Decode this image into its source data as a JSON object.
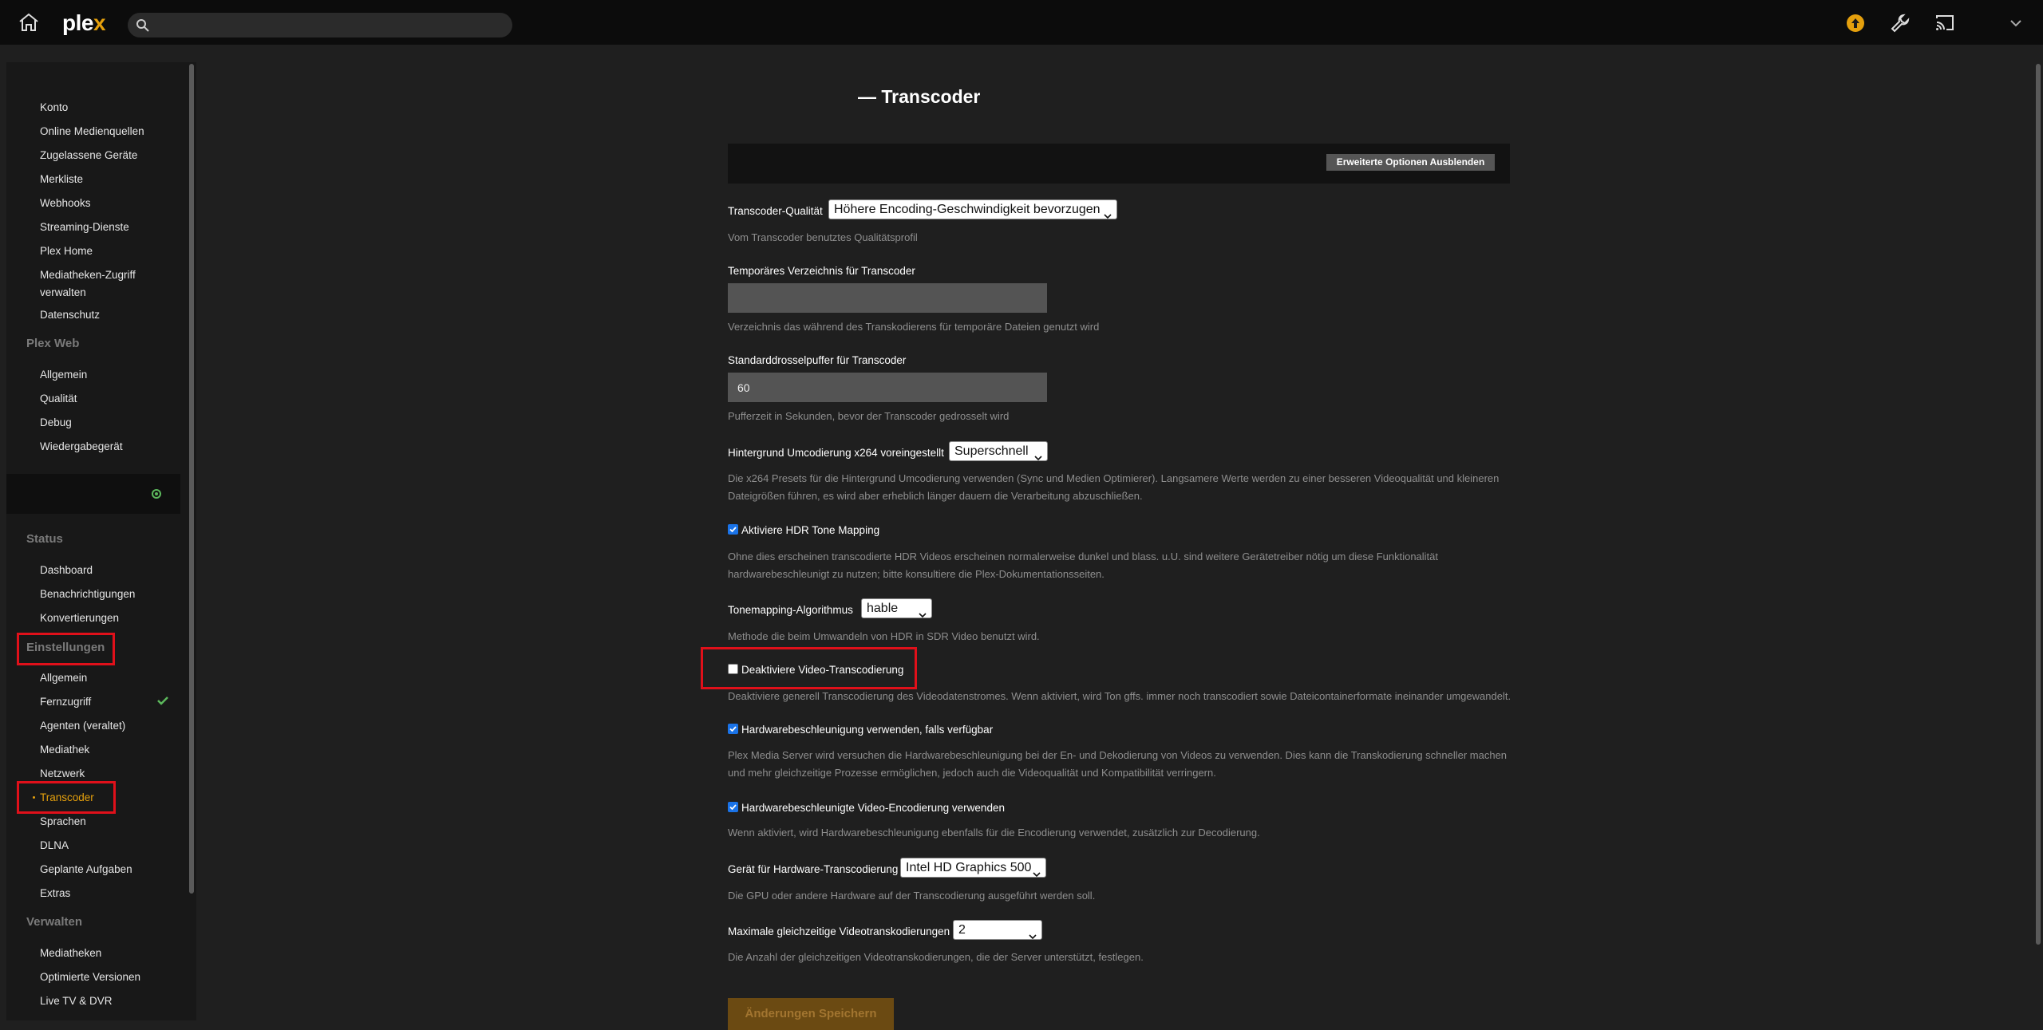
{
  "app": {
    "logo_pre": "ple",
    "logo_x": "x",
    "accent": "#e5a00d"
  },
  "search": {
    "placeholder": ""
  },
  "topbar_icons": [
    "home-icon",
    "upgrade-icon",
    "wrench-icon",
    "cast-icon",
    "chevron-down-icon"
  ],
  "sidebar": {
    "account_items": [
      "Konto",
      "Online Medienquellen",
      "Zugelassene Geräte",
      "Merkliste",
      "Webhooks",
      "Streaming-Dienste",
      "Plex Home",
      "Mediatheken-Zugriff verwalten",
      "Datenschutz"
    ],
    "plexweb_header": "Plex Web",
    "plexweb_items": [
      "Allgemein",
      "Qualität",
      "Debug",
      "Wiedergabegerät"
    ],
    "status_header": "Status",
    "status_items": [
      "Dashboard",
      "Benachrichtigungen",
      "Konvertierungen"
    ],
    "settings_header": "Einstellungen",
    "settings_items": [
      "Allgemein",
      "Fernzugriff",
      "Agenten (veraltet)",
      "Mediathek",
      "Netzwerk",
      "Transcoder",
      "Sprachen",
      "DLNA",
      "Geplante Aufgaben",
      "Extras"
    ],
    "manage_header": "Verwalten",
    "manage_items": [
      "Mediatheken",
      "Optimierte Versionen",
      "Live TV & DVR"
    ]
  },
  "main": {
    "title": "— Transcoder",
    "advanced_button": "Erweiterte Optionen Ausblenden",
    "quality": {
      "label": "Transcoder-Qualität",
      "value": "Höhere Encoding-Geschwindigkeit bevorzugen",
      "help": "Vom Transcoder benutztes Qualitätsprofil"
    },
    "tempdir": {
      "label": "Temporäres Verzeichnis für Transcoder",
      "value": "",
      "help": "Verzeichnis das während des Transkodierens für temporäre Dateien genutzt wird"
    },
    "throttle": {
      "label": "Standarddrosselpuffer für Transcoder",
      "value": "60",
      "help": "Pufferzeit in Sekunden, bevor der Transcoder gedrosselt wird"
    },
    "x264": {
      "label": "Hintergrund Umcodierung x264 voreingestellt",
      "value": "Superschnell",
      "help1": "Die x264 Presets für die Hintergrund Umcodierung verwenden (Sync und Medien Optimierer). Langsamere Werte werden zu einer besseren Videoqualität und kleineren",
      "help2": "Dateigrößen führen, es wird aber erheblich länger dauern die Verarbeitung abzuschließen."
    },
    "hdr": {
      "label": "Aktiviere HDR Tone Mapping",
      "checked": true,
      "help1": "Ohne dies erscheinen transcodierte HDR Videos erscheinen normalerweise dunkel und blass. u.U. sind weitere Gerätetreiber nötig um diese Funktionalität",
      "help2": "hardwarebeschleunigt zu nutzen; bitte konsultiere die Plex-Dokumentationsseiten."
    },
    "tonemap": {
      "label": "Tonemapping-Algorithmus",
      "value": "hable",
      "help": "Methode die beim Umwandeln von HDR in SDR Video benutzt wird."
    },
    "disable_video": {
      "label": "Deaktiviere Video-Transcodierung",
      "checked": false,
      "help": "Deaktiviere generell Transcodierung des Videodatenstromes. Wenn aktiviert, wird Ton gffs. immer noch transcodiert sowie Dateicontainerformate ineinander umgewandelt."
    },
    "hwaccel": {
      "label": "Hardwarebeschleunigung verwenden, falls verfügbar",
      "checked": true,
      "help1": "Plex Media Server wird versuchen die Hardwarebeschleunigung bei der En- und Dekodierung von Videos zu verwenden. Dies kann die Transkodierung schneller machen",
      "help2": "und mehr gleichzeitige Prozesse ermöglichen, jedoch auch die Videoqualität und Kompatibilität verringern."
    },
    "hwenc": {
      "label": "Hardwarebeschleunigte Video-Encodierung verwenden",
      "checked": true,
      "help": "Wenn aktiviert, wird Hardwarebeschleunigung ebenfalls für die Encodierung verwendet, zusätzlich zur Decodierung."
    },
    "device": {
      "label": "Gerät für Hardware-Transcodierung",
      "value": "Intel HD Graphics 500",
      "help": "Die GPU oder andere Hardware auf der Transcodierung ausgeführt werden soll."
    },
    "maxtrans": {
      "label": "Maximale gleichzeitige Videotranskodierungen",
      "value": "2",
      "help": "Die Anzahl der gleichzeitigen Videotranskodierungen, die der Server unterstützt, festlegen."
    },
    "save_button": "Änderungen Speichern"
  }
}
